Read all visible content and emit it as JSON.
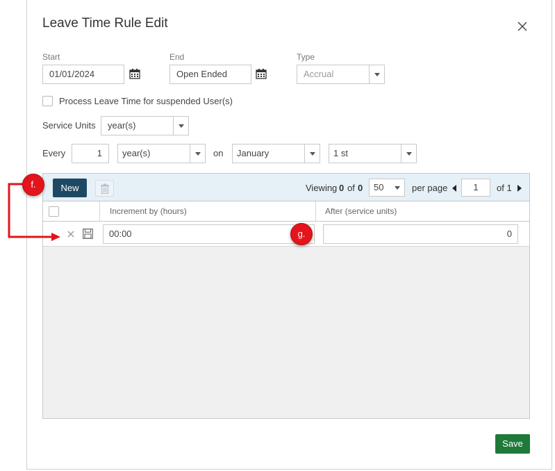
{
  "dialog": {
    "title": "Leave Time Rule Edit",
    "close_icon": "close-icon"
  },
  "form": {
    "start": {
      "label": "Start",
      "value": "01/01/2024"
    },
    "end": {
      "label": "End",
      "value": "Open Ended"
    },
    "type": {
      "label": "Type",
      "value": "Accrual"
    },
    "process_suspended_label": "Process Leave Time for suspended User(s)",
    "service_units": {
      "label": "Service Units",
      "value": "year(s)"
    },
    "every": {
      "label": "Every",
      "count": "1",
      "unit": "year(s)",
      "on_label": "on",
      "month": "January",
      "day": "1 st"
    }
  },
  "grid": {
    "new_label": "New",
    "viewing_label": "Viewing",
    "viewing_from": "0",
    "viewing_of_label": "of",
    "viewing_total": "0",
    "page_size": "50",
    "per_page_label": "per page",
    "page_number": "1",
    "page_of_label": "of 1",
    "columns": [
      "Increment by (hours)",
      "After (service units)"
    ],
    "rows": [
      {
        "increment": "00:00",
        "after": "0"
      }
    ]
  },
  "callouts": {
    "f": "f.",
    "g": "g."
  },
  "footer": {
    "save_label": "Save"
  },
  "colors": {
    "primary_button": "#1e4963",
    "save_button": "#1f7a3a",
    "callout": "#e3141b",
    "toolbar_bg": "#e6f0f7"
  }
}
